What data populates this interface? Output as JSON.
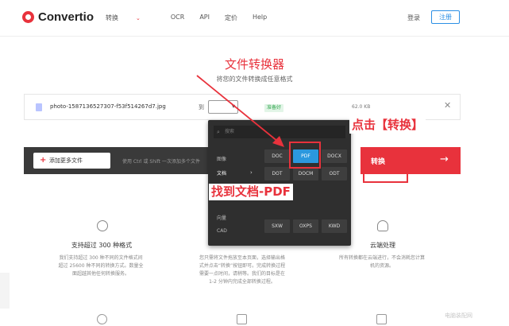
{
  "brand": {
    "name": "Convertio"
  },
  "nav": {
    "items": [
      {
        "label": "转换",
        "has_caret": true
      },
      {
        "label": "OCR"
      },
      {
        "label": "API"
      },
      {
        "label": "定价"
      },
      {
        "label": "Help"
      }
    ],
    "login": "登录",
    "signup": "注册"
  },
  "hero": {
    "title": "文件转换器",
    "subtitle": "将您的文件转换成任意格式"
  },
  "file": {
    "name": "photo-1587136527307-f53f514267d7.jpg",
    "to_label": "到",
    "status": "准备好",
    "size": "62.0 KB"
  },
  "actions": {
    "add_more": "添加更多文件",
    "hint": "使用 Ctrl 或 Shift 一次添加多个文件",
    "convert": "转换",
    "convert_arrow": "→"
  },
  "dropdown": {
    "search_placeholder": "搜索",
    "categories": [
      {
        "label": "图像",
        "active": false
      },
      {
        "label": "文档",
        "active": true
      },
      {
        "label": "向量",
        "active": false
      },
      {
        "label": "CAD",
        "active": false
      }
    ],
    "formats": [
      "DOC",
      "PDF",
      "DOCX",
      "DOT",
      "DOCM",
      "ODT",
      "SXW",
      "OXPS",
      "KWD"
    ],
    "selected": "PDF"
  },
  "annotations": {
    "click_convert": "点击【转换】",
    "find_pdf": "找到文档-PDF"
  },
  "features": [
    {
      "title": "支持超过 300 种格式",
      "text": "我们支持超过 300 种不同的文件格式间超过 25600 种不同的转换方式。数量全面超越其他任何转换服务。"
    },
    {
      "title": "",
      "text": "您只需将文件拖放至本页面，选择输出格式并点击“转换”按钮即可。完成转换过程需要一点时间，请稍等。我们的目标是在 1-2 分钟内完成全部转换过程。"
    },
    {
      "title": "云端处理",
      "text": "所有转换都在云端进行，不会消耗您计算机的资源。"
    }
  ],
  "watermark": "电脑装配网",
  "colors": {
    "brand_red": "#e8323c",
    "signup_blue": "#2b8fe5",
    "pdf_selected": "#2b98de"
  }
}
